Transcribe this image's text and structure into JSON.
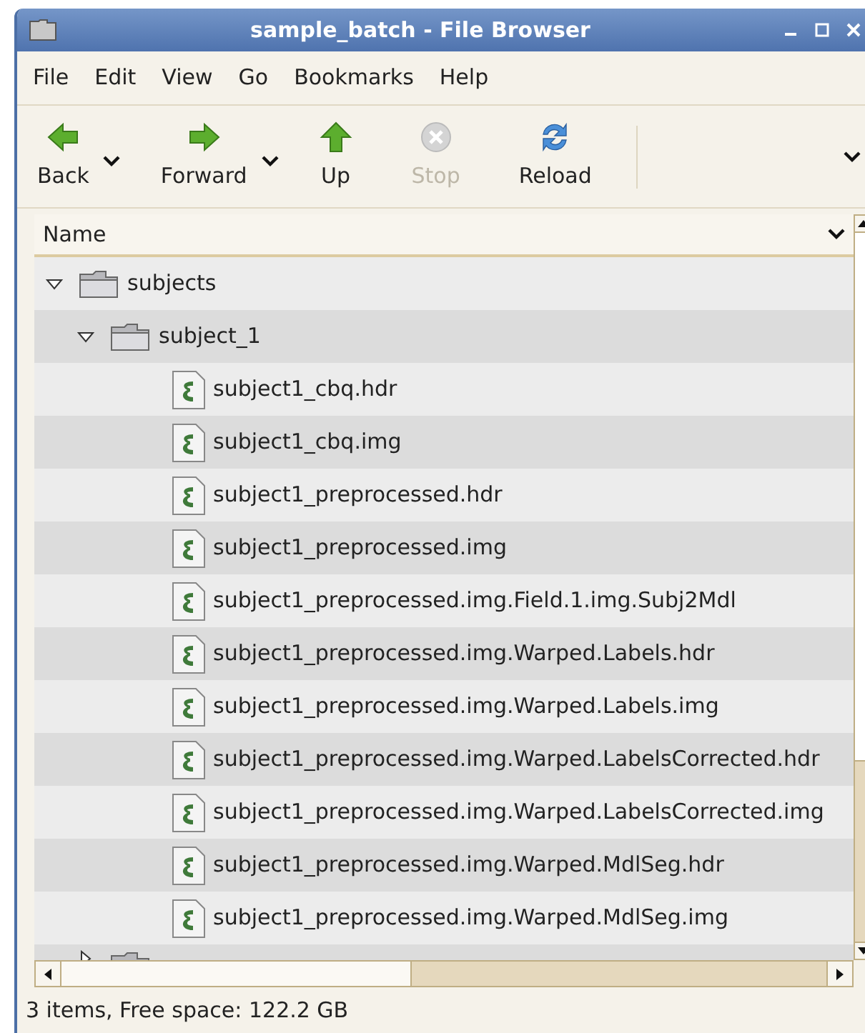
{
  "window": {
    "title": "sample_batch - File Browser"
  },
  "menu": [
    "File",
    "Edit",
    "View",
    "Go",
    "Bookmarks",
    "Help"
  ],
  "toolbar": [
    {
      "label": "Back",
      "kind": "back",
      "disabled": false,
      "dropdown": true
    },
    {
      "label": "Forward",
      "kind": "forward",
      "disabled": false,
      "dropdown": true
    },
    {
      "label": "Up",
      "kind": "up",
      "disabled": false,
      "dropdown": false
    },
    {
      "label": "Stop",
      "kind": "stop",
      "disabled": true,
      "dropdown": false
    },
    {
      "label": "Reload",
      "kind": "reload",
      "disabled": false,
      "dropdown": false
    }
  ],
  "list": {
    "column": "Name",
    "tree": [
      {
        "name": "subjects",
        "kind": "folder",
        "expanded": true,
        "children": [
          {
            "name": "subject_1",
            "kind": "folder",
            "expanded": true,
            "children": [
              {
                "name": "subject1_cbq.hdr",
                "kind": "file"
              },
              {
                "name": "subject1_cbq.img",
                "kind": "file"
              },
              {
                "name": "subject1_preprocessed.hdr",
                "kind": "file"
              },
              {
                "name": "subject1_preprocessed.img",
                "kind": "file"
              },
              {
                "name": "subject1_preprocessed.img.Field.1.img.Subj2Mdl",
                "kind": "file"
              },
              {
                "name": "subject1_preprocessed.img.Warped.Labels.hdr",
                "kind": "file"
              },
              {
                "name": "subject1_preprocessed.img.Warped.Labels.img",
                "kind": "file"
              },
              {
                "name": "subject1_preprocessed.img.Warped.LabelsCorrected.hdr",
                "kind": "file"
              },
              {
                "name": "subject1_preprocessed.img.Warped.LabelsCorrected.img",
                "kind": "file"
              },
              {
                "name": "subject1_preprocessed.img.Warped.MdlSeg.hdr",
                "kind": "file"
              },
              {
                "name": "subject1_preprocessed.img.Warped.MdlSeg.img",
                "kind": "file"
              }
            ]
          },
          {
            "kind": "folder",
            "expanded": false
          }
        ]
      }
    ]
  },
  "status_bar": "3 items, Free space: 122.2 GB"
}
